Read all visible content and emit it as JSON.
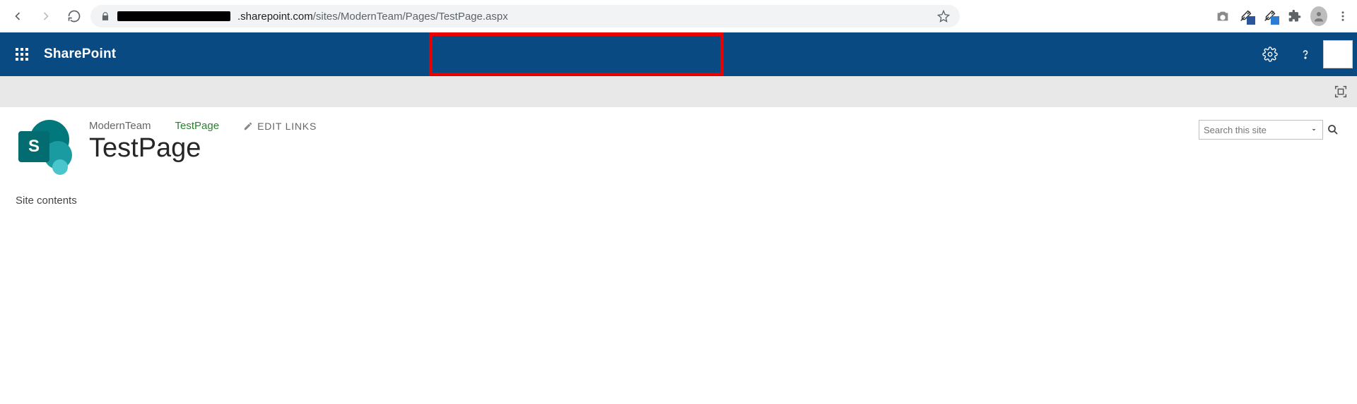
{
  "browser": {
    "url_domain_suffix": ".sharepoint.com",
    "url_path": "/sites/ModernTeam/Pages/TestPage.aspx"
  },
  "suite": {
    "brand": "SharePoint"
  },
  "breadcrumb": {
    "site": "ModernTeam",
    "page": "TestPage",
    "edit_links": "EDIT LINKS"
  },
  "page": {
    "title": "TestPage",
    "logo_letter": "S"
  },
  "search": {
    "placeholder": "Search this site"
  },
  "leftnav": {
    "item1": "Site contents"
  }
}
